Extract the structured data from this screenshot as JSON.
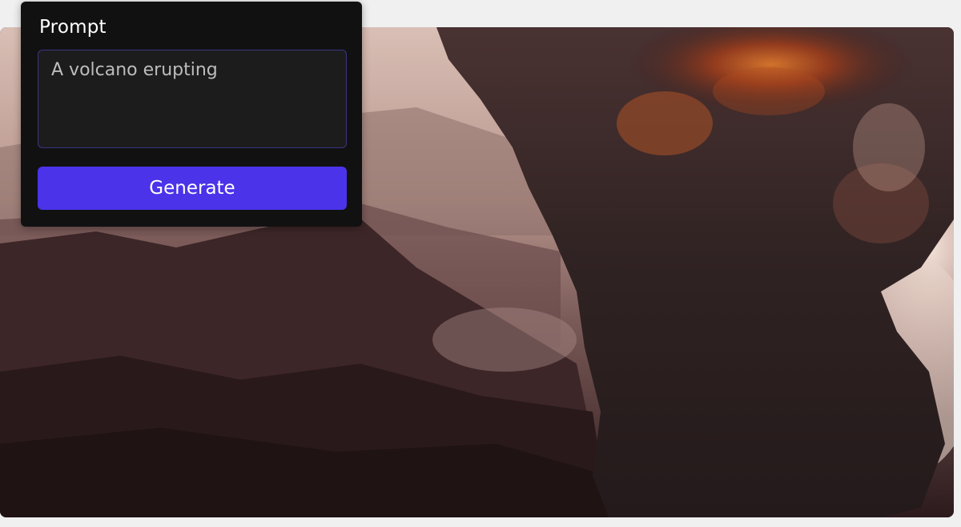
{
  "prompt_panel": {
    "label": "Prompt",
    "input_value": "A volcano erupting",
    "generate_label": "Generate"
  },
  "colors": {
    "page_background": "#f0f0f1",
    "panel_background": "#111112",
    "input_background": "#1c1c1d",
    "input_border": "#3b3480",
    "button_accent": "#4b33ea"
  }
}
